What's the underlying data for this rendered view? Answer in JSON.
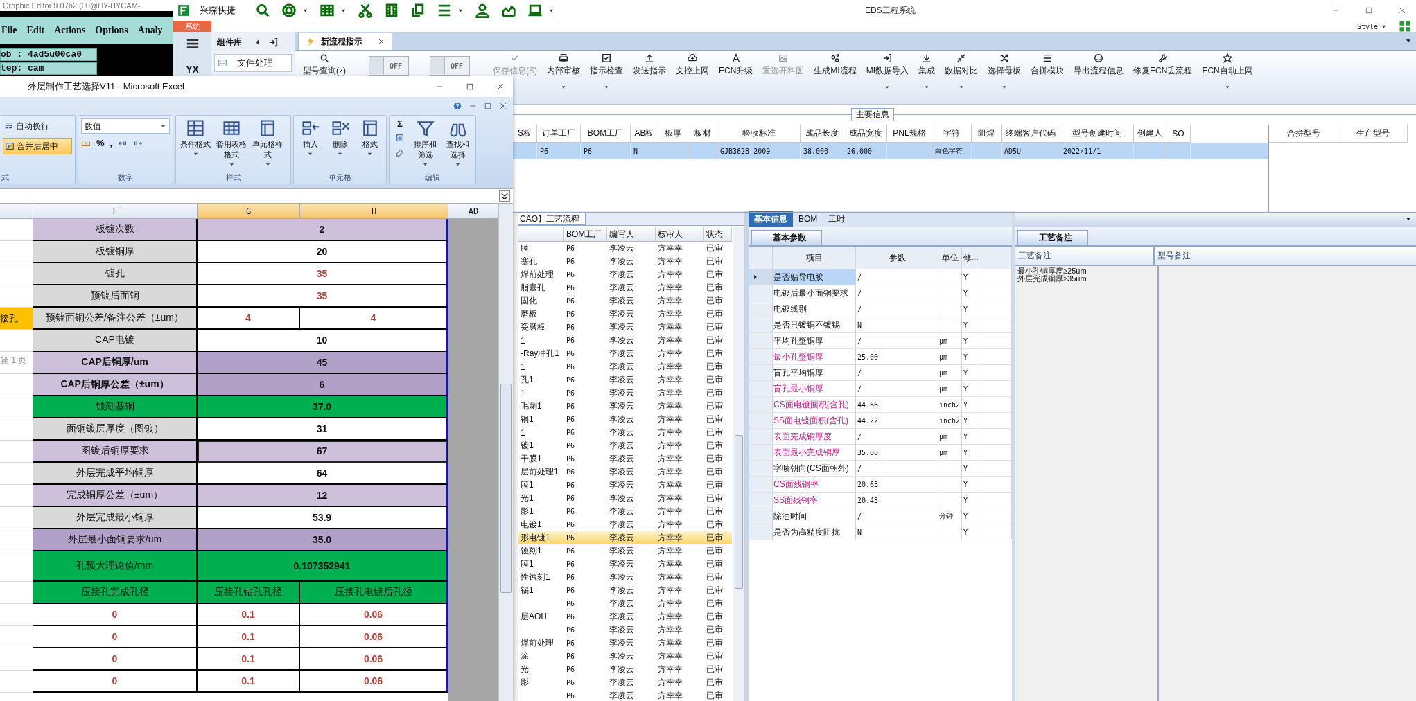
{
  "graphic_editor": {
    "title": "Graphic Editor 9.07b2 (00@HY-HYCAM-",
    "menu": [
      "File",
      "Edit",
      "Actions",
      "Options",
      "Analy"
    ],
    "job": "ob : 4ad5u00ca0",
    "step": "tep: cam"
  },
  "eds": {
    "quick_label": "兴森快捷",
    "title": "EDS工程系统",
    "style": "Style",
    "system_tab": "系统",
    "sidebar_code": "YX",
    "component_panel": {
      "title": "组件库",
      "items": [
        "文件处理"
      ]
    },
    "tabs": [
      {
        "label": "新流程指示",
        "selected": true
      }
    ],
    "ribbon": [
      {
        "kind": "button",
        "label": "型号查询(z)",
        "disabled": false,
        "menu": false
      },
      {
        "kind": "toggle",
        "label": "OFF",
        "on": false
      },
      {
        "kind": "toggle",
        "label": "OFF",
        "on": false
      },
      {
        "kind": "button",
        "label": "保存信息(S)",
        "disabled": true,
        "menu": false
      },
      {
        "kind": "button",
        "label": "内部审核",
        "disabled": false,
        "menu": true
      },
      {
        "kind": "button",
        "label": "指示检查",
        "disabled": false,
        "menu": true
      },
      {
        "kind": "button",
        "label": "发送指示",
        "disabled": false,
        "menu": false
      },
      {
        "kind": "button",
        "label": "文控上网",
        "disabled": false,
        "menu": false
      },
      {
        "kind": "button",
        "label": "ECN升级",
        "disabled": false,
        "menu": false
      },
      {
        "kind": "button",
        "label": "重选开料图",
        "disabled": true,
        "menu": false
      },
      {
        "kind": "button",
        "label": "生成MI流程",
        "disabled": false,
        "menu": false
      },
      {
        "kind": "button",
        "label": "MI数据导入",
        "disabled": false,
        "menu": true
      },
      {
        "kind": "button",
        "label": "集成",
        "disabled": false,
        "menu": true
      },
      {
        "kind": "button",
        "label": "数据对比",
        "disabled": false,
        "menu": true
      },
      {
        "kind": "button",
        "label": "选择母板",
        "disabled": false,
        "menu": true
      },
      {
        "kind": "button",
        "label": "合拼模块",
        "disabled": false,
        "menu": false
      },
      {
        "kind": "button",
        "label": "导出流程信息",
        "disabled": false,
        "menu": false
      },
      {
        "kind": "button",
        "label": "修复ECN丢流程",
        "disabled": false,
        "menu": false
      },
      {
        "kind": "button",
        "label": "ECN自动上网",
        "disabled": false,
        "menu": true
      }
    ],
    "main_info": {
      "title": "主要信息",
      "selected": true,
      "columns": [
        {
          "label": "S板"
        },
        {
          "label": "订单工厂",
          "value": "P6"
        },
        {
          "label": "BOM工厂",
          "value": "P6"
        },
        {
          "label": "AB板",
          "value": "N"
        },
        {
          "label": "板厚"
        },
        {
          "label": "板材"
        },
        {
          "label": "验收标准",
          "value": "GJB362B-2009"
        },
        {
          "label": "成品长度",
          "value": "38.000"
        },
        {
          "label": "成品宽度",
          "value": "26.000"
        },
        {
          "label": "PNL规格"
        },
        {
          "label": "字符",
          "value": "白色字符"
        },
        {
          "label": "阻焊"
        },
        {
          "label": "终端客户代码",
          "value": "AD5U"
        },
        {
          "label": "型号创建时间",
          "value": "2022/11/1"
        },
        {
          "label": "创建人"
        },
        {
          "label": "SO"
        }
      ],
      "side_columns": [
        "合拼型号",
        "生产型号"
      ]
    },
    "process": {
      "tab": "CAO】工艺流程",
      "columns": [
        "BOM工厂",
        "编写人",
        "核审人",
        "状态"
      ],
      "rows": [
        {
          "step": "膜",
          "factory": "P6",
          "writer": "李凌云",
          "reviewer": "方幸幸",
          "status": "已审",
          "selected": false
        },
        {
          "step": "塞孔",
          "factory": "P6",
          "writer": "李凌云",
          "reviewer": "方幸幸",
          "status": "已审",
          "selected": false
        },
        {
          "step": "焊前处理",
          "factory": "P6",
          "writer": "李凌云",
          "reviewer": "方幸幸",
          "status": "已审",
          "selected": false
        },
        {
          "step": "脂塞孔",
          "factory": "P6",
          "writer": "李凌云",
          "reviewer": "方幸幸",
          "status": "已审",
          "selected": false
        },
        {
          "step": "固化",
          "factory": "P6",
          "writer": "李凌云",
          "reviewer": "方幸幸",
          "status": "已审",
          "selected": false
        },
        {
          "step": "磨板",
          "factory": "P6",
          "writer": "李凌云",
          "reviewer": "方幸幸",
          "status": "已审",
          "selected": false
        },
        {
          "step": "瓷磨板",
          "factory": "P6",
          "writer": "李凌云",
          "reviewer": "方幸幸",
          "status": "已审",
          "selected": false
        },
        {
          "step": "1",
          "factory": "P6",
          "writer": "李凌云",
          "reviewer": "方幸幸",
          "status": "已审",
          "selected": false
        },
        {
          "step": "-Ray冲孔1",
          "factory": "P6",
          "writer": "李凌云",
          "reviewer": "方幸幸",
          "status": "已审",
          "selected": false
        },
        {
          "step": "1",
          "factory": "P6",
          "writer": "李凌云",
          "reviewer": "方幸幸",
          "status": "已审",
          "selected": false
        },
        {
          "step": "孔1",
          "factory": "P6",
          "writer": "李凌云",
          "reviewer": "方幸幸",
          "status": "已审",
          "selected": false
        },
        {
          "step": "1",
          "factory": "P6",
          "writer": "李凌云",
          "reviewer": "方幸幸",
          "status": "已审",
          "selected": false
        },
        {
          "step": "毛刺1",
          "factory": "P6",
          "writer": "李凌云",
          "reviewer": "方幸幸",
          "status": "已审",
          "selected": false
        },
        {
          "step": "铜1",
          "factory": "P6",
          "writer": "李凌云",
          "reviewer": "方幸幸",
          "status": "已审",
          "selected": false
        },
        {
          "step": "1",
          "factory": "P6",
          "writer": "李凌云",
          "reviewer": "方幸幸",
          "status": "已审",
          "selected": false
        },
        {
          "step": "镀1",
          "factory": "P6",
          "writer": "李凌云",
          "reviewer": "方幸幸",
          "status": "已审",
          "selected": false
        },
        {
          "step": "干膜1",
          "factory": "P6",
          "writer": "李凌云",
          "reviewer": "方幸幸",
          "status": "已审",
          "selected": false
        },
        {
          "step": "层前处理1",
          "factory": "P6",
          "writer": "李凌云",
          "reviewer": "方幸幸",
          "status": "已审",
          "selected": false
        },
        {
          "step": "膜1",
          "factory": "P6",
          "writer": "李凌云",
          "reviewer": "方幸幸",
          "status": "已审",
          "selected": false
        },
        {
          "step": "光1",
          "factory": "P6",
          "writer": "李凌云",
          "reviewer": "方幸幸",
          "status": "已审",
          "selected": false
        },
        {
          "step": "影1",
          "factory": "P6",
          "writer": "李凌云",
          "reviewer": "方幸幸",
          "status": "已审",
          "selected": false
        },
        {
          "step": "电镀1",
          "factory": "P6",
          "writer": "李凌云",
          "reviewer": "方幸幸",
          "status": "已审",
          "selected": false
        },
        {
          "step": "形电镀1",
          "factory": "P6",
          "writer": "李凌云",
          "reviewer": "方幸幸",
          "status": "已审",
          "selected": true
        },
        {
          "step": "蚀刻1",
          "factory": "P6",
          "writer": "李凌云",
          "reviewer": "方幸幸",
          "status": "已审",
          "selected": false
        },
        {
          "step": "膜1",
          "factory": "P6",
          "writer": "李凌云",
          "reviewer": "方幸幸",
          "status": "已审",
          "selected": false
        },
        {
          "step": "性蚀刻1",
          "factory": "P6",
          "writer": "李凌云",
          "reviewer": "方幸幸",
          "status": "已审",
          "selected": false
        },
        {
          "step": "锡1",
          "factory": "P6",
          "writer": "李凌云",
          "reviewer": "方幸幸",
          "status": "已审",
          "selected": false
        },
        {
          "factory": "P6",
          "writer": "李凌云",
          "reviewer": "方幸幸",
          "status": "已审",
          "selected": false
        },
        {
          "step": "层AOI1",
          "factory": "P6",
          "writer": "李凌云",
          "reviewer": "方幸幸",
          "status": "已审",
          "selected": false
        },
        {
          "factory": "P6",
          "writer": "李凌云",
          "reviewer": "方幸幸",
          "status": "已审",
          "selected": false
        },
        {
          "step": "焊前处理",
          "factory": "P6",
          "writer": "李凌云",
          "reviewer": "方幸幸",
          "status": "已审",
          "selected": false
        },
        {
          "step": "涂",
          "factory": "P6",
          "writer": "李凌云",
          "reviewer": "方幸幸",
          "status": "已审",
          "selected": false
        },
        {
          "step": "光",
          "factory": "P6",
          "writer": "李凌云",
          "reviewer": "方幸幸",
          "status": "已审",
          "selected": false
        },
        {
          "step": "影",
          "factory": "P6",
          "writer": "李凌云",
          "reviewer": "方幸幸",
          "status": "已审",
          "selected": false
        },
        {
          "factory": "P6",
          "writer": "李凌云",
          "reviewer": "方幸幸",
          "status": "已审",
          "selected": false
        }
      ]
    },
    "basic": {
      "tabs": [
        {
          "label": "基本信息",
          "selected": true
        },
        {
          "label": "BOM",
          "selected": false
        },
        {
          "label": "工时",
          "selected": false
        }
      ],
      "subtab": "基本参数",
      "columns": [
        "项目",
        "参数",
        "单位",
        "修..."
      ],
      "rows": [
        {
          "item": "是否贴导电胶",
          "value": "/",
          "mod": "Y",
          "flagged": false,
          "selected": true
        },
        {
          "item": "电镀后最小面铜要求",
          "value": "/",
          "mod": "Y",
          "flagged": false,
          "selected": false
        },
        {
          "item": "电镀线别",
          "value": "/",
          "mod": "Y",
          "flagged": false,
          "selected": false
        },
        {
          "item": "是否只镀铜不镀锡",
          "value": "N",
          "mod": "Y",
          "flagged": false,
          "selected": false
        },
        {
          "item": "平均孔壁铜厚",
          "value": "/",
          "unit": "μm",
          "mod": "Y",
          "flagged": false,
          "selected": false
        },
        {
          "item": "最小孔壁铜厚",
          "value": "25.00",
          "unit": "μm",
          "mod": "Y",
          "flagged": true,
          "selected": false
        },
        {
          "item": "盲孔平均铜厚",
          "value": "/",
          "unit": "μm",
          "mod": "Y",
          "flagged": false,
          "selected": false
        },
        {
          "item": "盲孔最小铜厚",
          "value": "/",
          "unit": "μm",
          "mod": "Y",
          "flagged": true,
          "selected": false
        },
        {
          "item": "CS面电镀面积(含孔)",
          "value": "44.66",
          "unit": "inch2",
          "mod": "Y",
          "flagged": true,
          "selected": false
        },
        {
          "item": "SS面电镀面积(含孔)",
          "value": "44.22",
          "unit": "inch2",
          "mod": "Y",
          "flagged": true,
          "selected": false
        },
        {
          "item": "表面完成铜厚度",
          "value": "/",
          "unit": "μm",
          "mod": "Y",
          "flagged": true,
          "selected": false
        },
        {
          "item": "表面最小完成铜厚",
          "value": "35.00",
          "unit": "μm",
          "mod": "Y",
          "flagged": true,
          "selected": false
        },
        {
          "item": "字唛朝向(CS面朝外)",
          "value": "/",
          "mod": "Y",
          "flagged": false,
          "selected": false
        },
        {
          "item": "CS面残铜率",
          "value": "20.63",
          "mod": "Y",
          "flagged": true,
          "selected": false
        },
        {
          "item": "SS面残铜率",
          "value": "20.43",
          "mod": "Y",
          "flagged": true,
          "selected": false
        },
        {
          "item": "除油时间",
          "value": "/",
          "unit": "分钟",
          "mod": "Y",
          "flagged": false,
          "selected": false
        },
        {
          "item": "是否为高精度阻抗",
          "value": "N",
          "mod": "Y",
          "flagged": false,
          "selected": false
        }
      ]
    },
    "notes": {
      "tab": "工艺备注",
      "columns": [
        "工艺备注",
        "型号备注"
      ],
      "lines": [
        "最小孔铜厚度≥25um",
        "外层完成铜厚≥35um"
      ]
    }
  },
  "excel": {
    "title": "外层制作工艺选择V11 - Microsoft Excel",
    "ribbon_groups": [
      {
        "kind": "alignment",
        "label": "式",
        "buttons": [
          {
            "label": "自动换行",
            "selected": false
          },
          {
            "label": "合并后居中",
            "selected": true
          }
        ]
      },
      {
        "kind": "number",
        "label": "数字",
        "format": "数值",
        "symbols": [
          "%",
          ","
        ]
      },
      {
        "kind": "large",
        "label": "样式",
        "buttons": [
          "条件格式",
          "套用表格格式",
          "单元格样式"
        ]
      },
      {
        "kind": "large",
        "label": "单元格",
        "buttons": [
          "插入",
          "删除",
          "格式"
        ]
      },
      {
        "kind": "edit",
        "label": "编辑",
        "sigma": "Σ",
        "buttons": [
          "排序和筛选",
          "查找和选择"
        ]
      }
    ],
    "columns": [
      {
        "label": "F",
        "selected": false
      },
      {
        "label": "G",
        "selected": true
      },
      {
        "label": "H",
        "selected": true
      },
      {
        "label": "AD",
        "selected": false
      }
    ],
    "page_label": "第 1 页",
    "rows": [
      {
        "kind": "data",
        "selected": false,
        "cells": [
          {
            "text": "板镀次数",
            "color": "#ccc0da",
            "bold": false,
            "red": false
          },
          {
            "text": "2",
            "color": "#ccc0da",
            "bold": true,
            "red": false
          }
        ]
      },
      {
        "kind": "data",
        "selected": false,
        "cells": [
          {
            "text": "板镀铜厚",
            "color": "#d9d9d9",
            "bold": false,
            "red": false
          },
          {
            "text": "20",
            "color": "#ffffff",
            "bold": true,
            "red": false
          }
        ]
      },
      {
        "kind": "data",
        "selected": false,
        "cells": [
          {
            "text": "镀孔",
            "color": "#d9d9d9",
            "bold": false,
            "red": false
          },
          {
            "text": "35",
            "color": "#ffffff",
            "bold": true,
            "red": true
          }
        ]
      },
      {
        "kind": "data",
        "selected": false,
        "cells": [
          {
            "text": "预镀后面铜",
            "color": "#d9d9d9",
            "bold": false,
            "red": false
          },
          {
            "text": "35",
            "color": "#ffffff",
            "bold": true,
            "red": true
          }
        ]
      },
      {
        "kind": "data",
        "selected": false,
        "margin": {
          "text": "接孔",
          "color": "#ffc000"
        },
        "cells": [
          {
            "text": "预镀面铜公差/备注公差（±um）",
            "color": "#d9d9d9",
            "bold": false,
            "red": false
          },
          {
            "text": "4",
            "color": "#ffffff",
            "bold": true,
            "red": true
          },
          {
            "text": "4",
            "color": "#ffffff",
            "bold": true,
            "red": true
          }
        ]
      },
      {
        "kind": "data",
        "selected": false,
        "cells": [
          {
            "text": "CAP电镀",
            "color": "#d9d9d9",
            "bold": false,
            "red": false
          },
          {
            "text": "10",
            "color": "#ffffff",
            "bold": true,
            "red": false
          }
        ]
      },
      {
        "kind": "data",
        "selected": false,
        "cells": [
          {
            "text": "CAP后铜厚/um",
            "color": "#ccc0da",
            "bold": true,
            "red": false
          },
          {
            "text": "45",
            "color": "#b1a0c7",
            "bold": true,
            "red": false
          }
        ]
      },
      {
        "kind": "data",
        "selected": false,
        "cells": [
          {
            "text": "CAP后铜厚公差（±um）",
            "color": "#ccc0da",
            "bold": true,
            "red": false
          },
          {
            "text": "6",
            "color": "#b1a0c7",
            "bold": true,
            "red": false
          }
        ]
      },
      {
        "kind": "data",
        "selected": false,
        "cells": [
          {
            "text": "蚀刻基铜",
            "color": "#00b050",
            "bold": false,
            "red": false
          },
          {
            "text": "37.0",
            "color": "#00b050",
            "bold": true,
            "red": false
          }
        ]
      },
      {
        "kind": "data",
        "selected": false,
        "cells": [
          {
            "text": "面铜镀层厚度（图镀）",
            "color": "#d9d9d9",
            "bold": false,
            "red": false
          },
          {
            "text": "31",
            "color": "#ffffff",
            "bold": true,
            "red": false
          }
        ]
      },
      {
        "kind": "data",
        "selected": true,
        "cells": [
          {
            "text": "图镀后铜厚要求",
            "color": "#ccc0da",
            "bold": false,
            "red": false
          },
          {
            "text": "67",
            "color": "#ccc0da",
            "bold": true,
            "red": false
          }
        ]
      },
      {
        "kind": "data",
        "selected": false,
        "cells": [
          {
            "text": "外层完成平均铜厚",
            "color": "#d9d9d9",
            "bold": false,
            "red": false
          },
          {
            "text": "64",
            "color": "#ffffff",
            "bold": true,
            "red": false
          }
        ]
      },
      {
        "kind": "data",
        "selected": false,
        "cells": [
          {
            "text": "完成铜厚公差（±um）",
            "color": "#ccc0da",
            "bold": false,
            "red": false
          },
          {
            "text": "12",
            "color": "#ccc0da",
            "bold": true,
            "red": false
          }
        ]
      },
      {
        "kind": "data",
        "selected": false,
        "cells": [
          {
            "text": "外层完成最小铜厚",
            "color": "#d9d9d9",
            "bold": false,
            "red": false
          },
          {
            "text": "53.9",
            "color": "#ffffff",
            "bold": true,
            "red": false
          }
        ]
      },
      {
        "kind": "data",
        "selected": false,
        "cells": [
          {
            "text": "外层最小面铜要求/um",
            "color": "#b1a0c7",
            "bold": false,
            "red": false
          },
          {
            "text": "35.0",
            "color": "#b1a0c7",
            "bold": true,
            "red": false
          }
        ]
      },
      {
        "kind": "result",
        "selected": false,
        "cells": [
          {
            "text": "孔预大理论值/mm",
            "color": "#00b050",
            "bold": false,
            "red": false
          },
          {
            "text": "0.107352941",
            "color": "#00b050",
            "bold": true,
            "red": false
          }
        ]
      },
      {
        "kind": "data",
        "selected": false,
        "cells": [
          {
            "text": "压接孔完成孔径",
            "color": "#00b050",
            "bold": false,
            "red": false
          },
          {
            "text": "压接孔钻孔孔径",
            "color": "#00b050",
            "bold": false,
            "red": false
          },
          {
            "text": "压接孔电镀后孔径",
            "color": "#00b050",
            "bold": false,
            "red": false
          }
        ]
      },
      {
        "kind": "data",
        "selected": false,
        "cells": [
          {
            "text": "0",
            "color": "#ffffff",
            "bold": true,
            "red": true
          },
          {
            "text": "0.1",
            "color": "#ffffff",
            "bold": true,
            "red": true
          },
          {
            "text": "0.06",
            "color": "#ffffff",
            "bold": true,
            "red": true
          }
        ]
      },
      {
        "kind": "data",
        "selected": false,
        "cells": [
          {
            "text": "0",
            "color": "#ffffff",
            "bold": true,
            "red": true
          },
          {
            "text": "0.1",
            "color": "#ffffff",
            "bold": true,
            "red": true
          },
          {
            "text": "0.06",
            "color": "#ffffff",
            "bold": true,
            "red": true
          }
        ]
      },
      {
        "kind": "data",
        "selected": false,
        "cells": [
          {
            "text": "0",
            "color": "#ffffff",
            "bold": true,
            "red": true
          },
          {
            "text": "0.1",
            "color": "#ffffff",
            "bold": true,
            "red": true
          },
          {
            "text": "0.06",
            "color": "#ffffff",
            "bold": true,
            "red": true
          }
        ]
      },
      {
        "kind": "data",
        "selected": false,
        "cells": [
          {
            "text": "0",
            "color": "#ffffff",
            "bold": true,
            "red": true
          },
          {
            "text": "0.1",
            "color": "#ffffff",
            "bold": true,
            "red": true
          },
          {
            "text": "0.06",
            "color": "#ffffff",
            "bold": true,
            "red": true
          }
        ]
      }
    ]
  }
}
